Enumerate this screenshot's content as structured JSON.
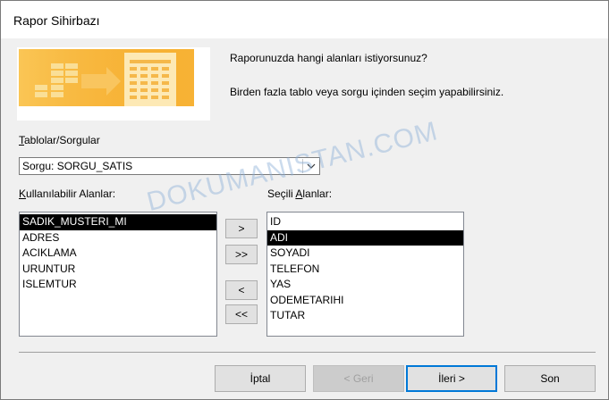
{
  "window": {
    "title": "Rapor Sihirbazı"
  },
  "intro": {
    "line1": "Raporunuzda hangi alanları istiyorsunuz?",
    "line2": "Birden fazla tablo veya sorgu içinden seçim yapabilirsiniz."
  },
  "source": {
    "label_first": "T",
    "label_rest": "ablolar/Sorgular",
    "selected": "Sorgu: SORGU_SATIS"
  },
  "available": {
    "label_first": "K",
    "label_rest": "ullanılabilir Alanlar:",
    "items": [
      "SADIK_MUSTERI_MI",
      "ADRES",
      "ACIKLAMA",
      "URUNTUR",
      "ISLEMTUR"
    ],
    "selected_index": 0
  },
  "selected_fields": {
    "label_pre": "Seçili ",
    "label_underlined": "A",
    "label_post": "lanlar:",
    "items": [
      "ID",
      "ADI",
      "SOYADI",
      "TELEFON",
      "YAS",
      "ODEMETARIHI",
      "TUTAR"
    ],
    "selected_index": 1
  },
  "move_buttons": {
    "add_one": ">",
    "add_all": ">>",
    "remove_one": "<",
    "remove_all": "<<"
  },
  "footer": {
    "cancel": "İptal",
    "back": "< Geri",
    "next": "İleri >",
    "finish": "Son"
  },
  "watermark": "DOKUMANISTAN.COM",
  "colors": {
    "accent": "#0078d7",
    "selection": "#000000",
    "wizard_orange": "#f5a623"
  }
}
